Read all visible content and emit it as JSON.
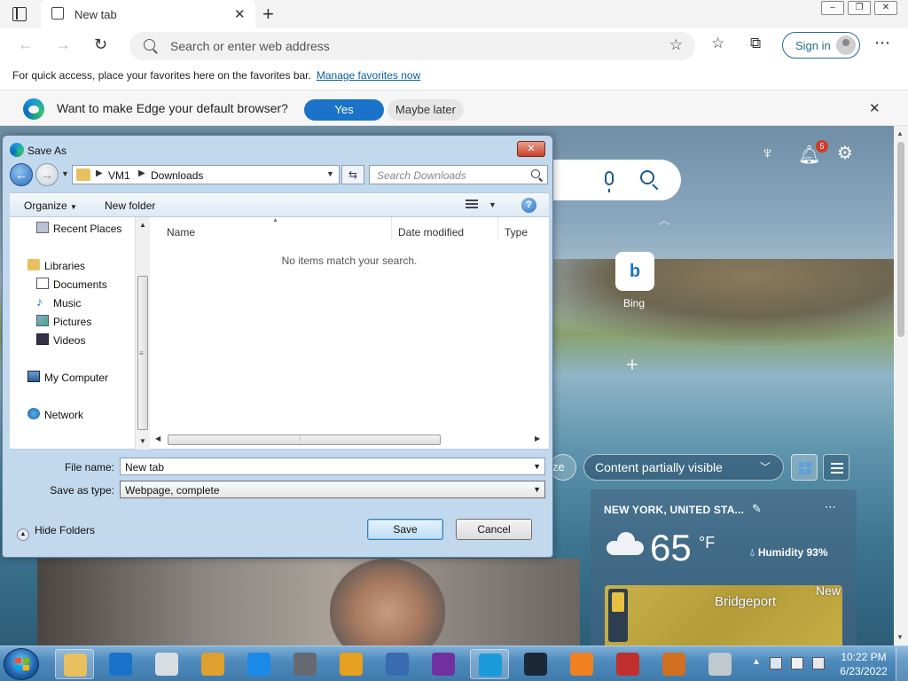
{
  "browser": {
    "tab_title": "New tab",
    "address_placeholder": "Search or enter web address",
    "signin_label": "Sign in",
    "favbar_text": "For quick access, place your favorites here on the favorites bar.",
    "favbar_link": "Manage favorites now",
    "infobar_text": "Want to make Edge your default browser?",
    "infobar_yes": "Yes",
    "infobar_later": "Maybe later"
  },
  "new_tab_page": {
    "notification_count": "5",
    "bing_label": "Bing",
    "content_fragment": "ze",
    "content_visibility": "Content partially visible",
    "weather": {
      "location": "NEW YORK, UNITED STA...",
      "temperature": "65",
      "unit": "°F",
      "humidity": "Humidity 93%",
      "map_city": "Bridgeport",
      "map_badge": "New"
    }
  },
  "dialog": {
    "title": "Save As",
    "path": [
      "VM1",
      "Downloads"
    ],
    "search_placeholder": "Search Downloads",
    "organize_label": "Organize",
    "new_folder_label": "New folder",
    "nav_items": [
      {
        "label": "Recent Places",
        "icon": "recent-places-icon"
      },
      {
        "label": "Libraries",
        "icon": "libraries-icon"
      },
      {
        "label": "Documents",
        "icon": "documents-icon"
      },
      {
        "label": "Music",
        "icon": "music-icon"
      },
      {
        "label": "Pictures",
        "icon": "pictures-icon"
      },
      {
        "label": "Videos",
        "icon": "videos-icon"
      },
      {
        "label": "My Computer",
        "icon": "computer-icon"
      },
      {
        "label": "Network",
        "icon": "network-icon"
      }
    ],
    "columns": [
      "Name",
      "Date modified",
      "Type"
    ],
    "empty_message": "No items match your search.",
    "file_name_label": "File name:",
    "file_name_value": "New tab",
    "save_type_label": "Save as type:",
    "save_type_value": "Webpage, complete",
    "hide_folders_label": "Hide Folders",
    "save_label": "Save",
    "cancel_label": "Cancel"
  },
  "taskbar": {
    "time": "10:22 PM",
    "date": "6/23/2022",
    "apps": [
      {
        "icon": "file-explorer-icon",
        "color": "#e8c060"
      },
      {
        "icon": "visual-studio-code-icon",
        "color": "#1a73c8"
      },
      {
        "icon": "roblox-studio-icon",
        "color": "#d8dde2"
      },
      {
        "icon": "xnview-icon",
        "color": "#e0a030"
      },
      {
        "icon": "roblox-icon",
        "color": "#1a8ae8"
      },
      {
        "icon": "google-earth-pro-icon",
        "color": "#666a70"
      },
      {
        "icon": "winamp-icon",
        "color": "#e8a020"
      },
      {
        "icon": "network-tool-icon",
        "color": "#3a6ab0"
      },
      {
        "icon": "onenote-icon",
        "color": "#7030a0"
      },
      {
        "icon": "edge-icon",
        "color": "#1a9ad9"
      },
      {
        "icon": "steam-icon",
        "color": "#1b2838"
      },
      {
        "icon": "vlc-icon",
        "color": "#f08020"
      },
      {
        "icon": "puzzle-app-icon",
        "color": "#c03030"
      },
      {
        "icon": "disc-burner-icon",
        "color": "#d07020"
      },
      {
        "icon": "calculator-icon",
        "color": "#c0c8d0"
      }
    ]
  }
}
